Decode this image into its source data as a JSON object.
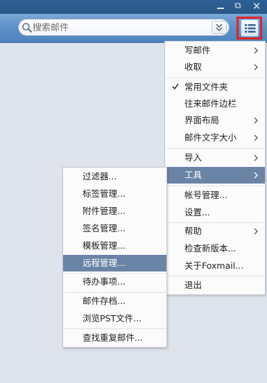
{
  "titlebar": {
    "minimize_glyph": "",
    "restore_glyph": "⧉",
    "close_glyph": "✕"
  },
  "search": {
    "placeholder": "搜索邮件",
    "value": ""
  },
  "colors": {
    "titlebar": "#2a5888",
    "toolbar": "#5b8ec7",
    "highlight": "#6a84a6",
    "menu_button_frame": "#e02424",
    "background": "#dfe4ec"
  },
  "main_menu": {
    "items": [
      {
        "label": "写邮件",
        "submenu": true
      },
      {
        "label": "收取",
        "submenu": true
      },
      {
        "label": "常用文件夹",
        "checked": true
      },
      {
        "label": "往来邮件边栏"
      },
      {
        "label": "界面布局",
        "submenu": true
      },
      {
        "label": "邮件文字大小",
        "submenu": true
      },
      {
        "label": "导入",
        "submenu": true
      },
      {
        "label": "工具",
        "submenu": true,
        "active": true
      },
      {
        "label": "帐号管理..."
      },
      {
        "label": "设置..."
      },
      {
        "label": "帮助",
        "submenu": true
      },
      {
        "label": "检查新版本..."
      },
      {
        "label": "关于Foxmail..."
      },
      {
        "label": "退出"
      }
    ]
  },
  "tools_submenu": {
    "items": [
      {
        "label": "过滤器..."
      },
      {
        "label": "标签管理..."
      },
      {
        "label": "附件管理..."
      },
      {
        "label": "签名管理..."
      },
      {
        "label": "模板管理..."
      },
      {
        "label": "远程管理...",
        "active": true
      },
      {
        "label": "待办事项..."
      },
      {
        "label": "邮件存档..."
      },
      {
        "label": "浏览PST文件..."
      },
      {
        "label": "查找重复邮件..."
      }
    ]
  }
}
